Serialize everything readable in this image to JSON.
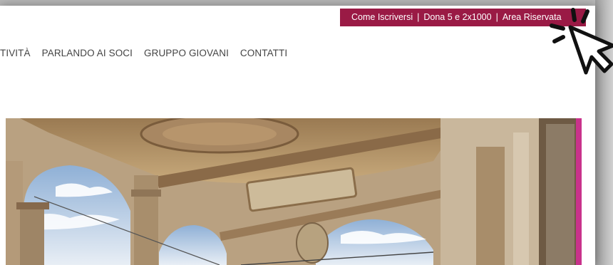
{
  "topbar": {
    "link_join": "Come Iscriversi",
    "sep1": "|",
    "link_donate": "Dona 5 e 2x1000",
    "sep2": "|",
    "link_reserved": "Area Riservata"
  },
  "nav": {
    "items": [
      {
        "label": "TIVITÀ"
      },
      {
        "label": "PARLANDO AI SOCI"
      },
      {
        "label": "GRUPPO GIOVANI"
      },
      {
        "label": "CONTATTI"
      }
    ]
  },
  "colors": {
    "topbar_bg": "#9a1a45",
    "nav_text": "#444444",
    "accent_pink": "#c8328b"
  },
  "icons": {
    "cursor": "click-cursor-icon"
  }
}
